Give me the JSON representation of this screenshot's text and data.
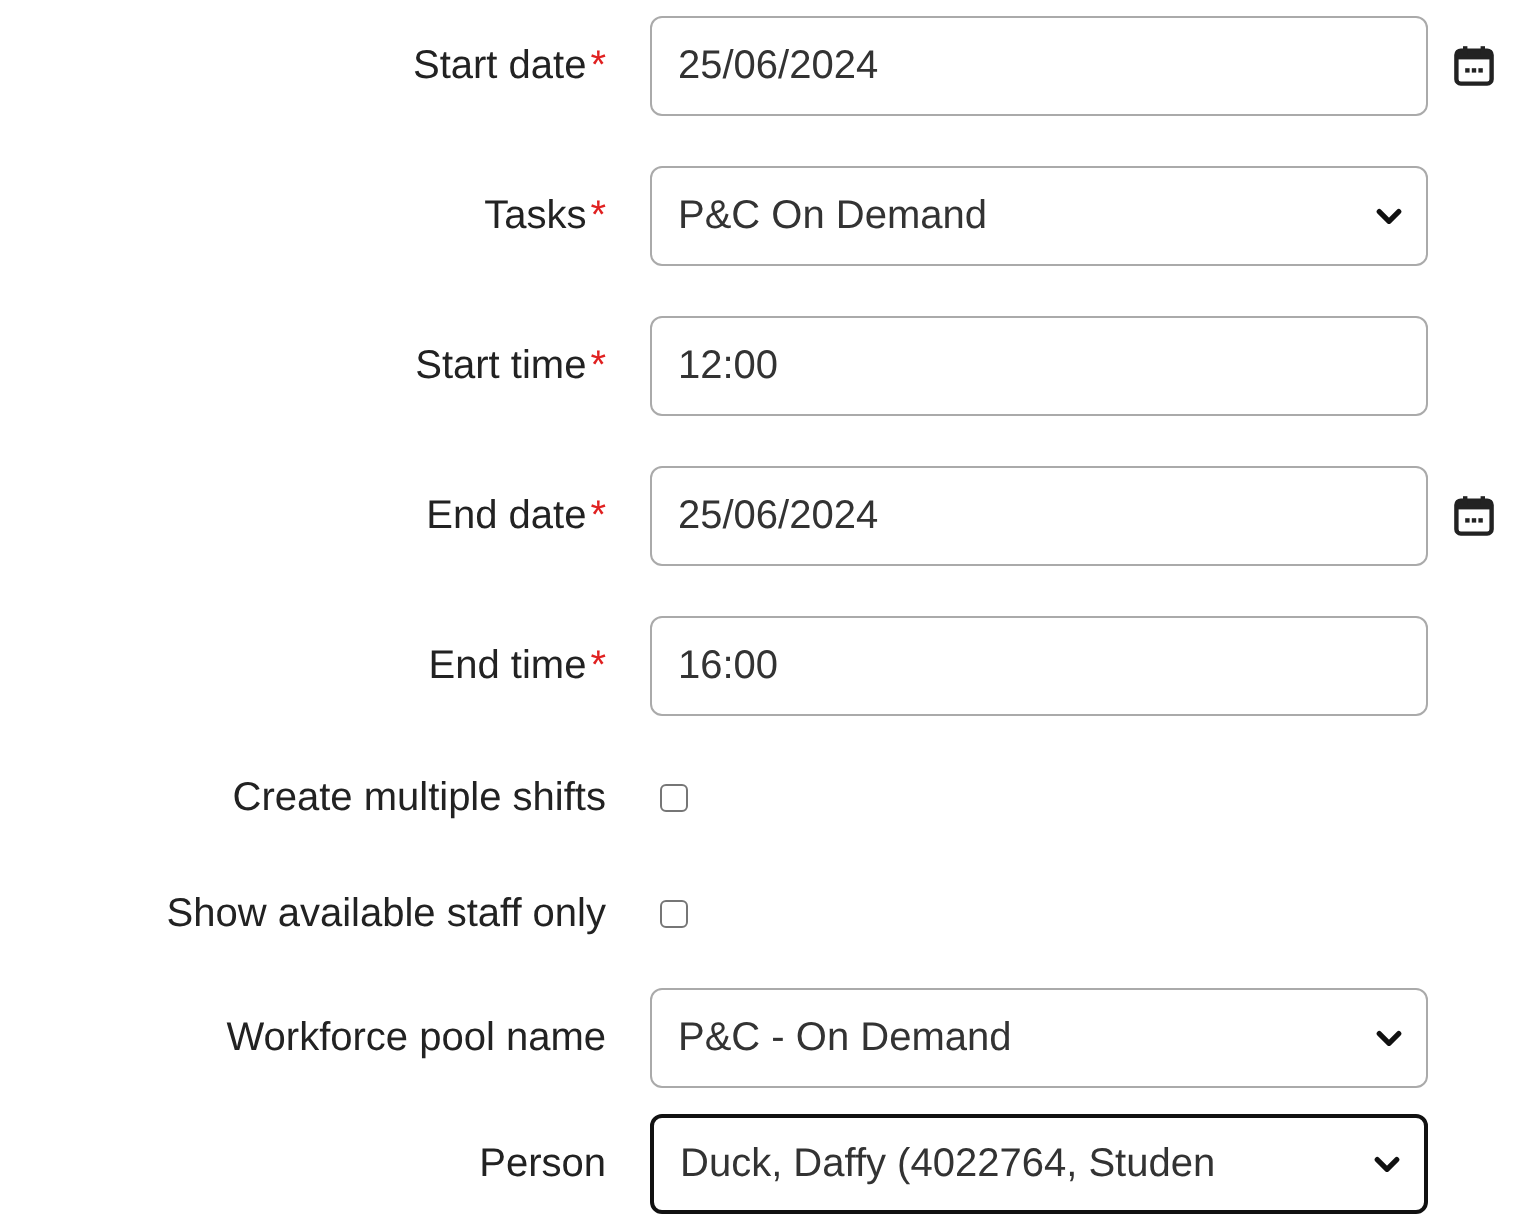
{
  "fields": [
    {
      "kind": "date",
      "label": "Start date",
      "required_mark": "*",
      "value": "25/06/2024"
    },
    {
      "kind": "select",
      "label": "Tasks",
      "required_mark": "*",
      "value": "P&C On Demand",
      "focused": false
    },
    {
      "kind": "text",
      "label": "Start time",
      "required_mark": "*",
      "value": "12:00"
    },
    {
      "kind": "date",
      "label": "End date",
      "required_mark": "*",
      "value": "25/06/2024"
    },
    {
      "kind": "text",
      "label": "End time",
      "required_mark": "*",
      "value": "16:00"
    },
    {
      "kind": "checkbox",
      "label": "Create multiple shifts",
      "checked": false
    },
    {
      "kind": "checkbox",
      "label": "Show available staff only",
      "checked": false
    },
    {
      "kind": "select",
      "label": "Workforce pool name",
      "value": "P&C - On Demand",
      "focused": false
    },
    {
      "kind": "select",
      "label": "Person",
      "value": "Duck, Daffy (4022764, Studen",
      "focused": true
    }
  ]
}
